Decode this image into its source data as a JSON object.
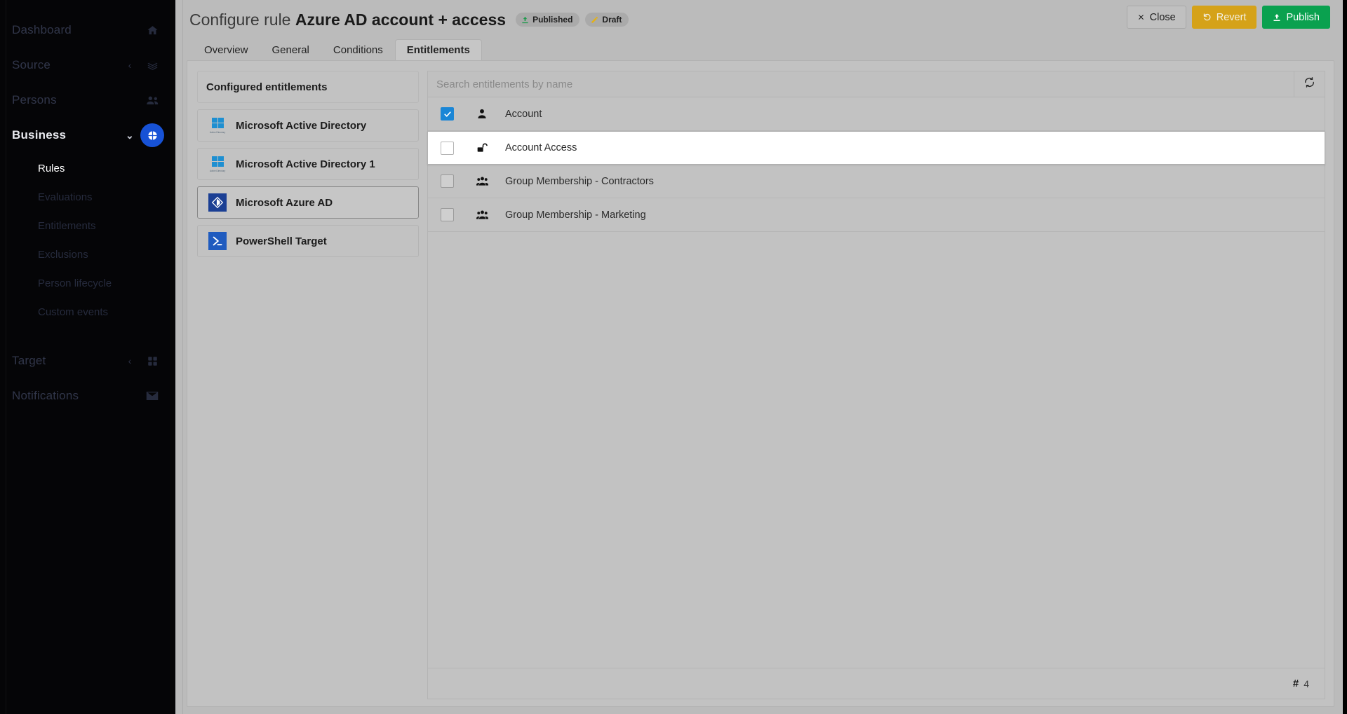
{
  "sidebar": {
    "items": [
      {
        "label": "Dashboard",
        "icon": "home-icon",
        "state": "idle",
        "chevron": ""
      },
      {
        "label": "Source",
        "icon": "layers-icon",
        "state": "idle",
        "chevron": "‹"
      },
      {
        "label": "Persons",
        "icon": "people-icon",
        "state": "idle",
        "chevron": ""
      },
      {
        "label": "Business",
        "icon": "pie-chart-icon",
        "state": "active",
        "chevron": "⌄"
      }
    ],
    "sub_items": [
      {
        "label": "Rules",
        "selected": true
      },
      {
        "label": "Evaluations",
        "selected": false
      },
      {
        "label": "Entitlements",
        "selected": false
      },
      {
        "label": "Exclusions",
        "selected": false
      },
      {
        "label": "Person lifecycle",
        "selected": false
      },
      {
        "label": "Custom events",
        "selected": false
      }
    ],
    "bottom_items": [
      {
        "label": "Target",
        "icon": "grid-icon",
        "chevron": "‹"
      },
      {
        "label": "Notifications",
        "icon": "envelope-icon",
        "chevron": ""
      }
    ]
  },
  "header": {
    "title_prefix": "Configure rule",
    "title_name": "Azure AD account + access",
    "badges": [
      {
        "label": "Published",
        "icon": "upload-icon",
        "color": "#1f9a4d"
      },
      {
        "label": "Draft",
        "icon": "pencil-icon",
        "color": "#e3b116"
      }
    ],
    "actions": [
      {
        "label": "Close",
        "icon": "x-icon",
        "style": "neutral"
      },
      {
        "label": "Revert",
        "icon": "undo-icon",
        "style": "warning"
      },
      {
        "label": "Publish",
        "icon": "upload-icon",
        "style": "success"
      }
    ]
  },
  "tabs": [
    {
      "label": "Overview",
      "active": false
    },
    {
      "label": "General",
      "active": false
    },
    {
      "label": "Conditions",
      "active": false
    },
    {
      "label": "Entitlements",
      "active": true
    }
  ],
  "systems_panel": {
    "header": "Configured entitlements",
    "tiles": [
      {
        "label": "Microsoft Active Directory",
        "icon": "windows-ad-icon",
        "icon_caption": "Active Directory",
        "selected": false
      },
      {
        "label": "Microsoft Active Directory 1",
        "icon": "windows-ad-icon",
        "icon_caption": "Active Directory",
        "selected": false
      },
      {
        "label": "Microsoft Azure AD",
        "icon": "azure-ad-icon",
        "icon_caption": "",
        "selected": true
      },
      {
        "label": "PowerShell Target",
        "icon": "powershell-icon",
        "icon_caption": "",
        "selected": false
      }
    ]
  },
  "entitlements_panel": {
    "search": {
      "value": "",
      "placeholder": "Search entitlements by name"
    },
    "refresh_icon": "refresh-icon",
    "rows": [
      {
        "label": "Account",
        "icon": "user-icon",
        "checked": true,
        "hover": false
      },
      {
        "label": "Account Access",
        "icon": "unlock-icon",
        "checked": false,
        "hover": true
      },
      {
        "label": "Group Membership - Contractors",
        "icon": "group-icon",
        "checked": false,
        "hover": false
      },
      {
        "label": "Group Membership - Marketing",
        "icon": "group-icon",
        "checked": false,
        "hover": false
      }
    ],
    "footer": {
      "hash": "#",
      "count": "4"
    }
  },
  "colors": {
    "sidebar_bg": "#050507",
    "accent_blue": "#1752d6",
    "checkbox_blue": "#1a86d6",
    "publish_green": "#0aa14f",
    "revert_gold": "#d5a219",
    "panel_bg": "#c2c2c2"
  }
}
